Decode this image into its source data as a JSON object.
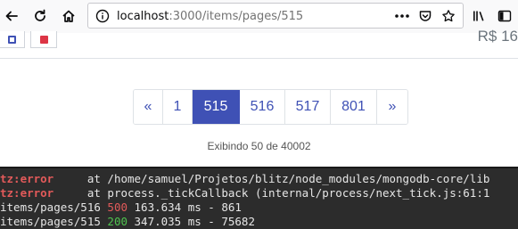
{
  "browser": {
    "url_host": "localhost",
    "url_path": ":3000/items/pages/515",
    "icons": {
      "back": "back-arrow-icon",
      "reload": "reload-icon",
      "home": "home-icon",
      "info": "info-icon",
      "more": "more-actions-icon",
      "bookmark": "bookmark-star-icon",
      "library": "library-icon",
      "sidebar": "sidebar-icon"
    }
  },
  "row": {
    "price": "R$ 16"
  },
  "pagination": {
    "prev": "«",
    "pages": [
      "1",
      "515",
      "516",
      "517",
      "801"
    ],
    "active": "515",
    "next": "»"
  },
  "status": "Exibindo 50 de 40002",
  "terminal": {
    "lines": [
      {
        "label": "tz:error",
        "text": "     at /home/samuel/Projetos/blitz/node_modules/mongodb-core/lib"
      },
      {
        "label": "tz:error",
        "text": "     at process._tickCallback (internal/process/next_tick.js:61:1"
      },
      {
        "prefix": "items/pages/516 ",
        "code": "500",
        "rest": " 163.634 ms - 861"
      },
      {
        "prefix": "items/pages/515 ",
        "code": "200",
        "rest": " 347.035 ms - 75682"
      }
    ]
  },
  "colors": {
    "accent": "#3f51b5",
    "danger": "#dc3545",
    "success": "#4fc24f"
  }
}
